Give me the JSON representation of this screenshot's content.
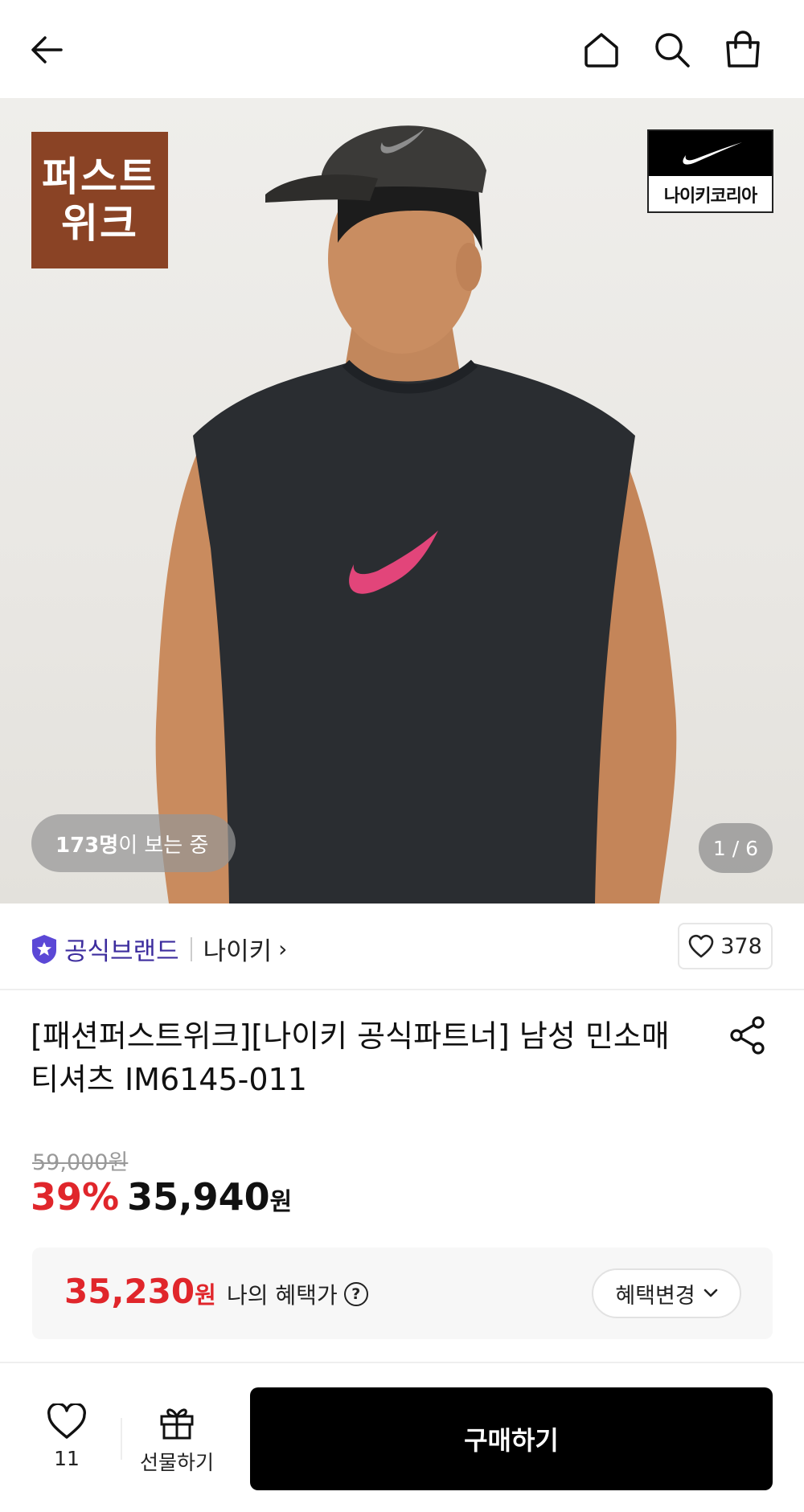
{
  "header": {
    "back_icon": "arrow-left-icon",
    "home_icon": "home-icon",
    "search_icon": "search-icon",
    "cart_icon": "shopping-bag-icon"
  },
  "hero": {
    "badge_text": "퍼스트\n위크",
    "brand_logo_text": "나이키코리아",
    "viewers_count": "173명",
    "viewers_suffix": "이 보는 중",
    "page_indicator": "1 / 6",
    "badge_color": "#8a4325"
  },
  "brand": {
    "official_label": "공식브랜드",
    "name": "나이키",
    "chevron": "›",
    "like_count": "378",
    "accent_color": "#3d2d9e"
  },
  "product": {
    "title": "[패션퍼스트위크][나이키 공식파트너] 남성 민소매 티셔츠 IM6145-011",
    "original_price": "59,000원",
    "discount": "39%",
    "sale_price": "35,940",
    "currency": "원"
  },
  "benefit": {
    "price": "35,230",
    "currency": "원",
    "label": "나의 혜택가",
    "help": "?",
    "change_button": "혜택변경",
    "price_color": "#e0262b"
  },
  "bottom": {
    "wish_count": "11",
    "gift_label": "선물하기",
    "buy_label": "구매하기"
  }
}
